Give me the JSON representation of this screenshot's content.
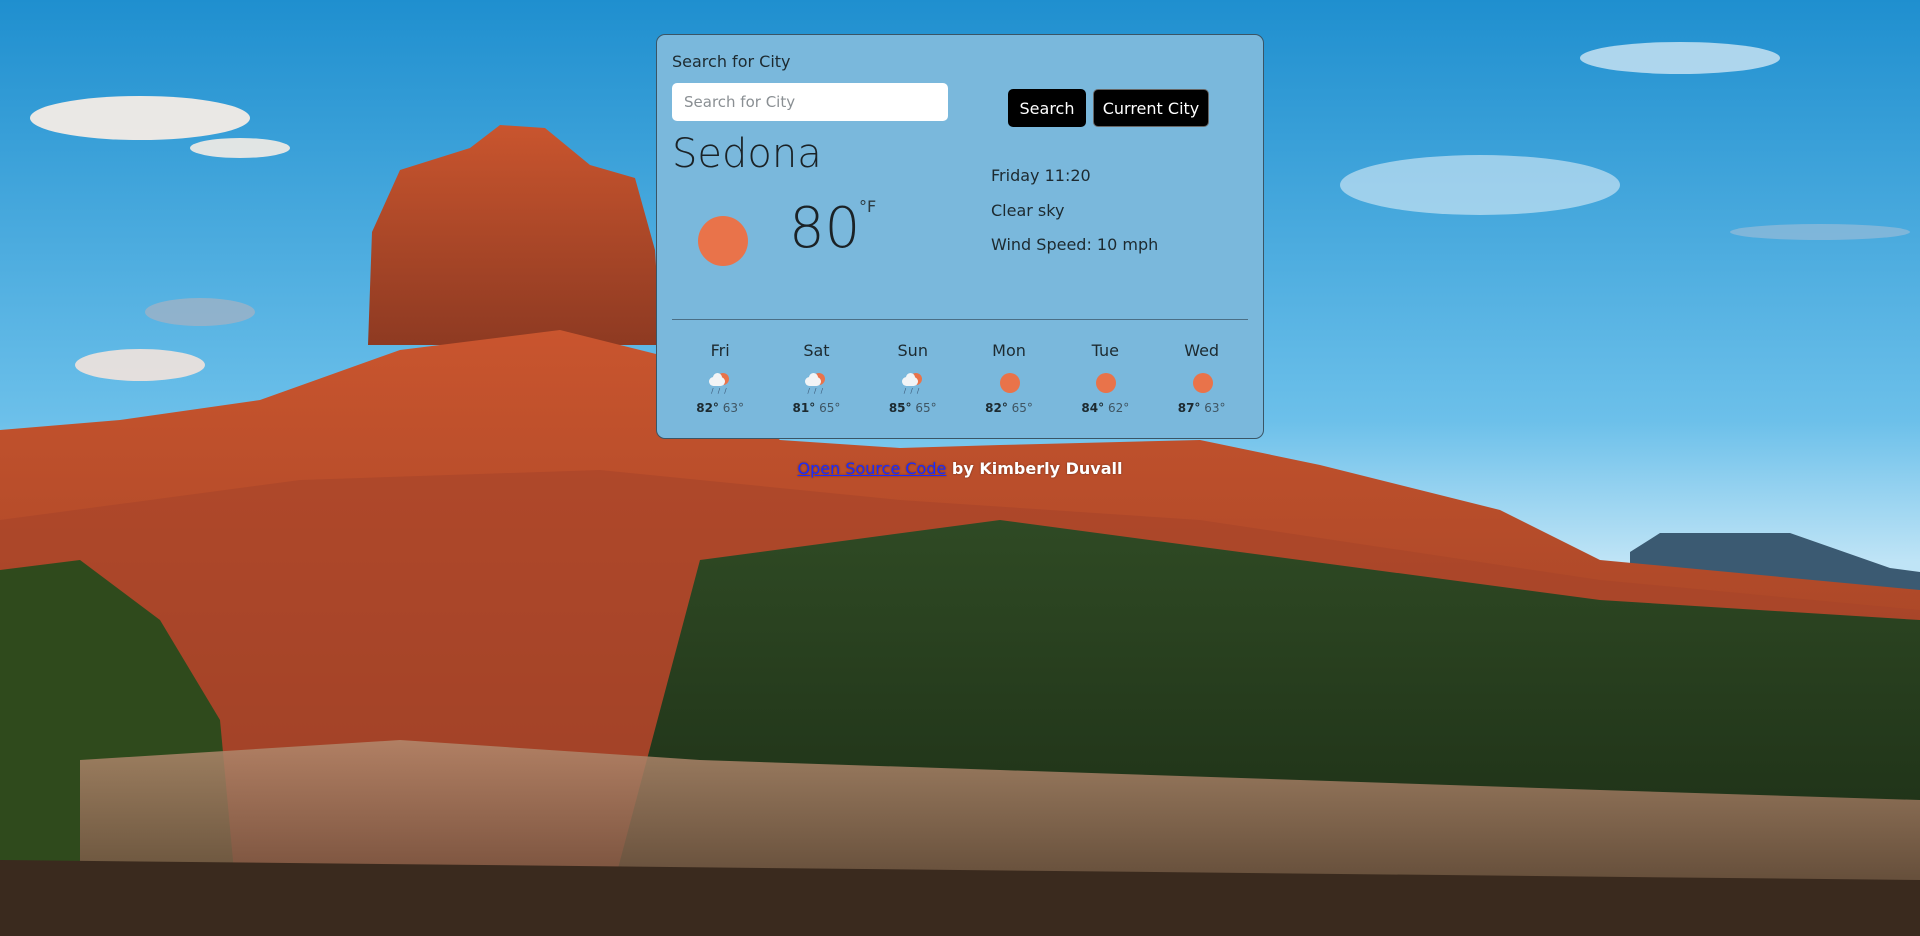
{
  "search": {
    "label": "Search for City",
    "placeholder": "Search for City",
    "value": "",
    "search_button": "Search",
    "current_city_button": "Current City"
  },
  "current": {
    "city": "Sedona",
    "temperature": "80",
    "unit": "°F",
    "day_time": "Friday 11:20",
    "description": "Clear sky",
    "wind": "Wind Speed: 10 mph",
    "icon": "sun-icon"
  },
  "forecast": [
    {
      "day": "Fri",
      "max": "82°",
      "min": "63°",
      "icon": "rain-cloud-icon"
    },
    {
      "day": "Sat",
      "max": "81°",
      "min": "65°",
      "icon": "rain-cloud-icon"
    },
    {
      "day": "Sun",
      "max": "85°",
      "min": "65°",
      "icon": "rain-cloud-icon"
    },
    {
      "day": "Mon",
      "max": "82°",
      "min": "65°",
      "icon": "sun-icon"
    },
    {
      "day": "Tue",
      "max": "84°",
      "min": "62°",
      "icon": "sun-icon"
    },
    {
      "day": "Wed",
      "max": "87°",
      "min": "63°",
      "icon": "sun-icon"
    }
  ],
  "footer": {
    "link_text": "Open Source Code",
    "credit": " by Kimberly Duvall"
  },
  "colors": {
    "card_bg": "#7ab8dc",
    "sun": "#e9734a",
    "button_bg": "#000000",
    "link": "#1a2cff"
  }
}
